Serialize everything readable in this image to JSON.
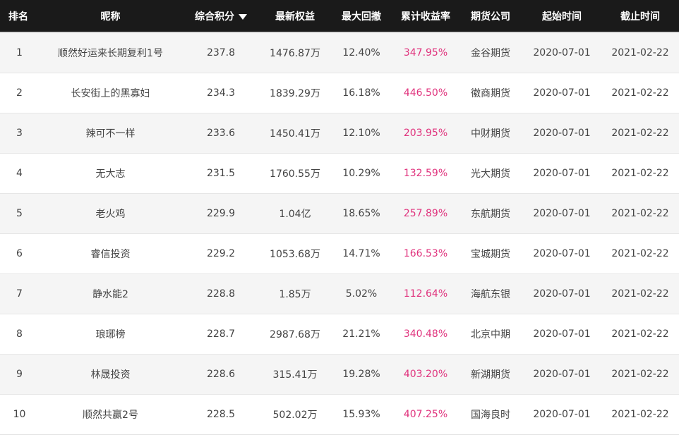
{
  "colors": {
    "header_bg": "#1a1a1a",
    "return_text": "#e0337d",
    "row_alt": "#f5f5f5"
  },
  "header": {
    "rank": "排名",
    "nickname": "昵称",
    "score": "综合积分",
    "equity": "最新权益",
    "max_drawdown": "最大回撤",
    "cum_return": "累计收益率",
    "company": "期货公司",
    "start": "起始时间",
    "end": "截止时间",
    "sort_icon": "caret-down-icon"
  },
  "rows": [
    {
      "rank": "1",
      "nickname": "顺然好运来长期复利1号",
      "score": "237.8",
      "equity": "1476.87万",
      "max_drawdown": "12.40%",
      "cum_return": "347.95%",
      "company": "金谷期货",
      "start": "2020-07-01",
      "end": "2021-02-22"
    },
    {
      "rank": "2",
      "nickname": "长安街上的黑寡妇",
      "score": "234.3",
      "equity": "1839.29万",
      "max_drawdown": "16.18%",
      "cum_return": "446.50%",
      "company": "徽商期货",
      "start": "2020-07-01",
      "end": "2021-02-22"
    },
    {
      "rank": "3",
      "nickname": "辣可不一样",
      "score": "233.6",
      "equity": "1450.41万",
      "max_drawdown": "12.10%",
      "cum_return": "203.95%",
      "company": "中财期货",
      "start": "2020-07-01",
      "end": "2021-02-22"
    },
    {
      "rank": "4",
      "nickname": "无大志",
      "score": "231.5",
      "equity": "1760.55万",
      "max_drawdown": "10.29%",
      "cum_return": "132.59%",
      "company": "光大期货",
      "start": "2020-07-01",
      "end": "2021-02-22"
    },
    {
      "rank": "5",
      "nickname": "老火鸡",
      "score": "229.9",
      "equity": "1.04亿",
      "max_drawdown": "18.65%",
      "cum_return": "257.89%",
      "company": "东航期货",
      "start": "2020-07-01",
      "end": "2021-02-22"
    },
    {
      "rank": "6",
      "nickname": "睿信投资",
      "score": "229.2",
      "equity": "1053.68万",
      "max_drawdown": "14.71%",
      "cum_return": "166.53%",
      "company": "宝城期货",
      "start": "2020-07-01",
      "end": "2021-02-22"
    },
    {
      "rank": "7",
      "nickname": "静水能2",
      "score": "228.8",
      "equity": "1.85万",
      "max_drawdown": "5.02%",
      "cum_return": "112.64%",
      "company": "海航东银",
      "start": "2020-07-01",
      "end": "2021-02-22"
    },
    {
      "rank": "8",
      "nickname": "琅琊榜",
      "score": "228.7",
      "equity": "2987.68万",
      "max_drawdown": "21.21%",
      "cum_return": "340.48%",
      "company": "北京中期",
      "start": "2020-07-01",
      "end": "2021-02-22"
    },
    {
      "rank": "9",
      "nickname": "林晟投资",
      "score": "228.6",
      "equity": "315.41万",
      "max_drawdown": "19.28%",
      "cum_return": "403.20%",
      "company": "新湖期货",
      "start": "2020-07-01",
      "end": "2021-02-22"
    },
    {
      "rank": "10",
      "nickname": "顺然共赢2号",
      "score": "228.5",
      "equity": "502.02万",
      "max_drawdown": "15.93%",
      "cum_return": "407.25%",
      "company": "国海良时",
      "start": "2020-07-01",
      "end": "2021-02-22"
    }
  ]
}
